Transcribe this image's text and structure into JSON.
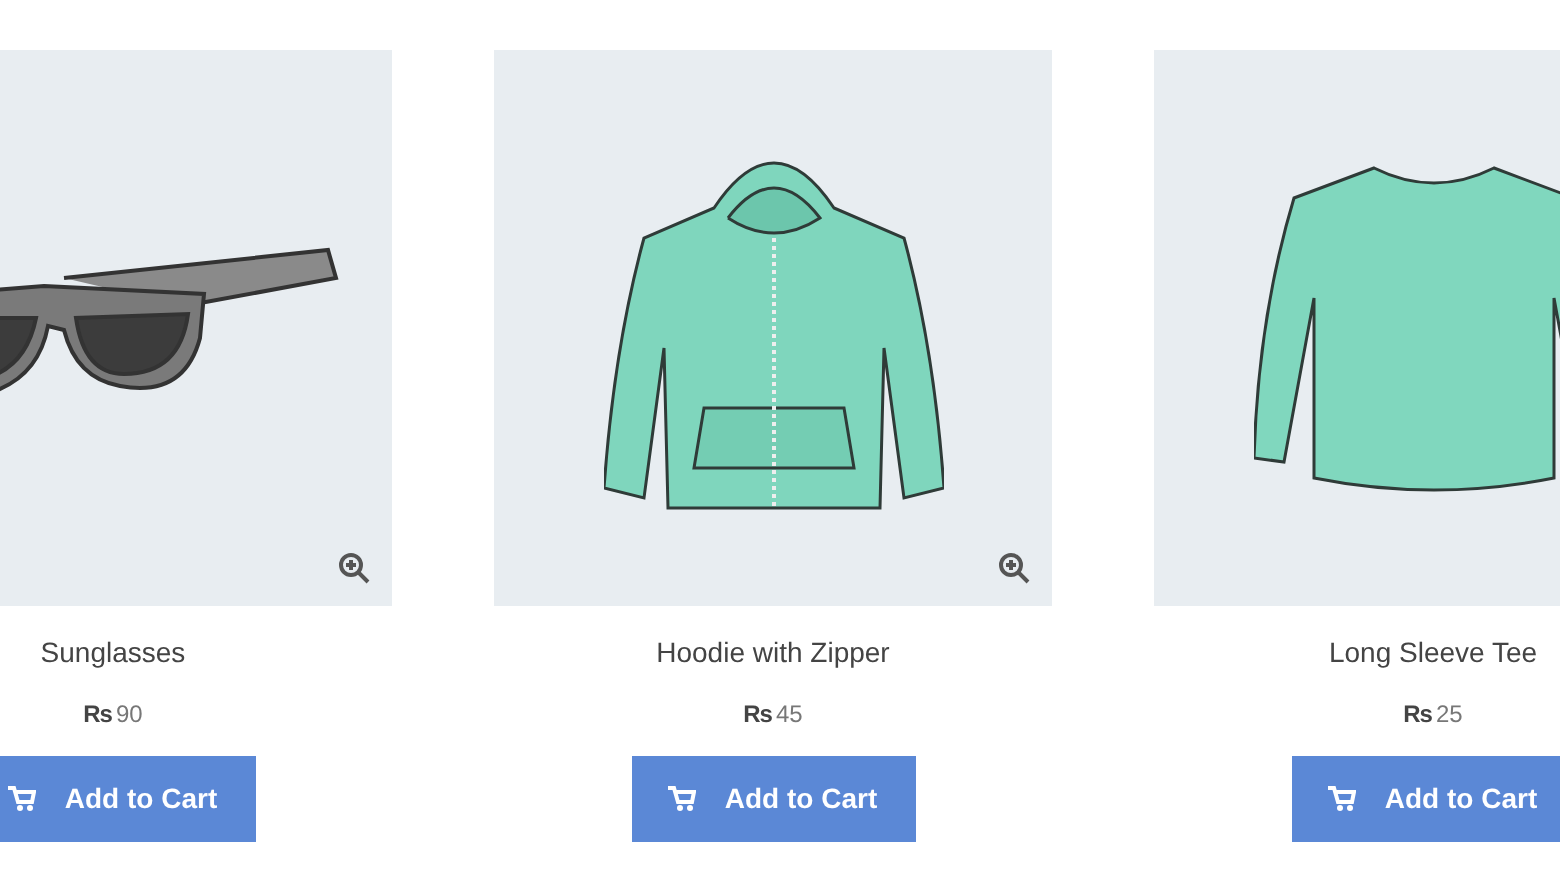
{
  "products": [
    {
      "kind": "sunglasses",
      "name": "Sunglasses",
      "currency": "Rs",
      "amount": "90",
      "button": "Add to Cart",
      "zoom_icon": true
    },
    {
      "kind": "hoodie",
      "name": "Hoodie with Zipper",
      "currency": "Rs",
      "amount": "45",
      "button": "Add to Cart",
      "zoom_icon": true
    },
    {
      "kind": "tee",
      "name": "Long Sleeve Tee",
      "currency": "Rs",
      "amount": "25",
      "button": "Add to Cart"
    }
  ]
}
